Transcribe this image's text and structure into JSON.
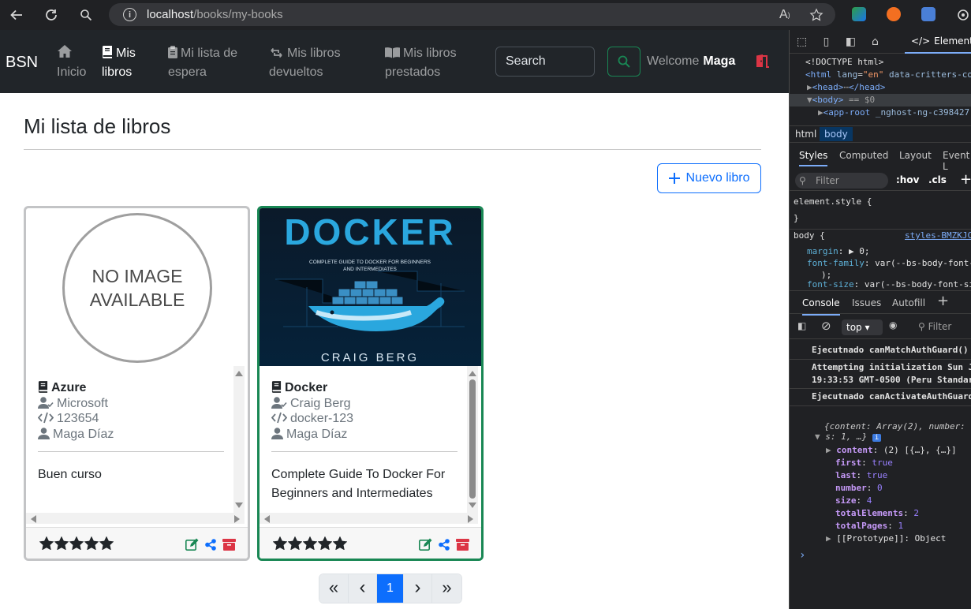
{
  "browser": {
    "url_host": "localhost",
    "url_path": "/books/my-books",
    "reader_mode": "A",
    "colors": {
      "frame": "#202124",
      "urlbar": "#35363a"
    }
  },
  "navbar": {
    "brand": "BSN",
    "items": [
      {
        "label": "Inicio",
        "icon": "home-icon",
        "active": false
      },
      {
        "label": "Mis libros",
        "icon": "book-icon",
        "active": true
      },
      {
        "label": "Mi lista de espera",
        "icon": "clipboard-icon",
        "active": false
      },
      {
        "label": "Mis libros devueltos",
        "icon": "retweet-icon",
        "active": false
      },
      {
        "label": "Mis libros prestados",
        "icon": "open-book-icon",
        "active": false
      }
    ],
    "item_lines": [
      [
        "Inicio"
      ],
      [
        "Mis",
        "libros"
      ],
      [
        "Mi lista de",
        "espera"
      ],
      [
        "Mis libros",
        "devueltos"
      ],
      [
        "Mis libros",
        "prestados"
      ]
    ],
    "search_placeholder": "Search",
    "welcome_label": "Welcome",
    "user_name": "Maga",
    "colors": {
      "bg": "#212529",
      "success": "#198754",
      "danger": "#dc3545"
    }
  },
  "page": {
    "title": "Mi lista de libros",
    "new_book_label": "Nuevo libro",
    "accent": "#0d6efd"
  },
  "books": [
    {
      "title": "Azure",
      "author": "Microsoft",
      "isbn": "123654",
      "owner": "Maga Díaz",
      "synopsis": "Buen curso",
      "rating": 5,
      "cover_placeholder": "NO IMAGE AVAILABLE",
      "selected": false
    },
    {
      "title": "Docker",
      "author": "Craig Berg",
      "isbn": "docker-123",
      "owner": "Maga Díaz",
      "synopsis": "Complete Guide To Docker For Beginners and Intermediates",
      "rating": 5,
      "cover": {
        "headline": "DOCKER",
        "subtitle": "COMPLETE GUIDE TO DOCKER FOR BEGINNERS AND INTERMEDIATES",
        "author": "CRAIG BERG"
      },
      "selected": true
    }
  ],
  "pagination": {
    "first": "«",
    "prev": "‹",
    "current": "1",
    "next": "›",
    "last": "»"
  },
  "devtools": {
    "elements_tab": "Elements",
    "dom": {
      "doctype": "<!DOCTYPE html>",
      "html_open": "<html",
      "html_attr_lang": "lang",
      "html_lang_val": "\"en\"",
      "html_attr2": "data-critters-co",
      "head": "<head>",
      "head_close": "</head>",
      "body": "<body>",
      "body_ref": "== $0",
      "app_root": "<app-root",
      "app_root_attr": "_nghost-ng-c398427"
    },
    "breadcrumbs": [
      "html",
      "body"
    ],
    "style_tabs": [
      "Styles",
      "Computed",
      "Layout",
      "Event L"
    ],
    "filter_placeholder": "Filter",
    "hov": ":hov",
    "cls": ".cls",
    "styles": {
      "element_style": "element.style {",
      "close": "}",
      "body_rule": "body {",
      "source": "styles-BMZKJC",
      "margin_prop": "margin",
      "margin_val": "▶ 0;",
      "font_family_prop": "font-family",
      "font_family_val": "var(--bs-body-font-",
      "paren": ");",
      "font_size_prop": "font-size",
      "font_size_val": "var(--bs-body-font-si"
    },
    "console_tabs": [
      "Console",
      "Issues",
      "Autofill"
    ],
    "context": "top",
    "console_filter": "Filter",
    "console": {
      "line1": "Ejecutnado canMatchAuthGuard()",
      "line2a": "Attempting initialization Sun J",
      "line2b": "19:33:53 GMT-0500 (Peru Standar",
      "line3": "Ejecutnado canActivateAuthGuard",
      "obj_summary_a": "{content: Array(2), number: (",
      "obj_summary_b": "s: 1, …}",
      "content": "(2) [{…}, {…}]",
      "first": "true",
      "last": "true",
      "number": "0",
      "size": "4",
      "totalElements": "2",
      "totalPages": "1",
      "prototype": "[[Prototype]]: Object"
    }
  }
}
